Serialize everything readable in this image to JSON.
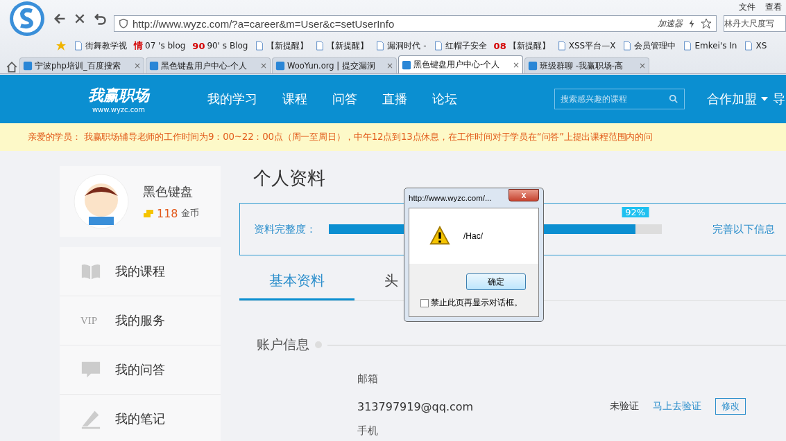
{
  "browser": {
    "menu": [
      "文件",
      "查看"
    ],
    "address": "http://www.wyzc.com/?a=career&m=User&c=setUserInfo",
    "accelerator": "加速器",
    "search_value": "林丹大尺度写",
    "bookmarks": [
      {
        "label": "街舞教学视"
      },
      {
        "label": "07 's blog",
        "icon_text": "情"
      },
      {
        "label": "90' s Blog",
        "icon_text": "90"
      },
      {
        "label": "【新提醒】"
      },
      {
        "label": "【新提醒】"
      },
      {
        "label": "漏洞时代 -"
      },
      {
        "label": "红帽子安全"
      },
      {
        "label": "【新提醒】",
        "icon_text": "08"
      },
      {
        "label": "XSS平台—X"
      },
      {
        "label": "会员管理中"
      },
      {
        "label": "Emkei's In"
      },
      {
        "label": "XS"
      }
    ],
    "tabs": [
      {
        "title": "宁波php培训_百度搜索",
        "close": "×",
        "selected": false
      },
      {
        "title": "黑色键盘用户中心-个人",
        "close": "×",
        "selected": false
      },
      {
        "title": "WooYun.org | 提交漏洞",
        "close": "×",
        "selected": false
      },
      {
        "title": "黑色键盘用户中心-个人",
        "close": "×",
        "selected": true
      },
      {
        "title": "班级群聊 -我赢职场-高",
        "close": "×",
        "selected": false
      }
    ]
  },
  "site": {
    "logo": "我赢职场",
    "logo_url": "www.wyzc.com",
    "nav": [
      "我的学习",
      "课程",
      "问答",
      "直播",
      "论坛"
    ],
    "search_placeholder": "搜索感兴趣的课程",
    "partner": "合作加盟",
    "nav_cut": "导"
  },
  "notice": "亲爱的学员： 我赢职场辅导老师的工作时间为9：00~22：00点（周一至周日），中午12点到13点休息，在工作时间对于学员在“问答”上提出课程范围内的问",
  "profile": {
    "name": "黑色键盘",
    "coins": "118",
    "coin_unit": "金币"
  },
  "sidebar": [
    {
      "kind": "book",
      "label": "我的课程"
    },
    {
      "kind": "vip",
      "icon_text": "VIP",
      "label": "我的服务"
    },
    {
      "kind": "question",
      "label": "我的问答"
    },
    {
      "kind": "pen",
      "label": "我的笔记"
    }
  ],
  "page_title": "个人资料",
  "completeness": {
    "label": "资料完整度：",
    "level": 0.92,
    "reading": "92%",
    "link": "完善以下信息"
  },
  "tabs": [
    {
      "label": "基本资料",
      "selected": true
    },
    {
      "label": "头",
      "selected": false
    }
  ],
  "section": "账户信息",
  "email": {
    "label": "邮箱",
    "value": "313797919@qq.com",
    "status": "未验证",
    "verify": "马上去验证",
    "edit": "修改"
  },
  "phone_label": "手机",
  "dialog": {
    "title": "http://www.wyzc.com/...",
    "close": "x",
    "message": "/Hac/",
    "ok": "确定",
    "checkbox": {
      "label": "禁止此页再显示对话框。",
      "checked": false
    }
  }
}
